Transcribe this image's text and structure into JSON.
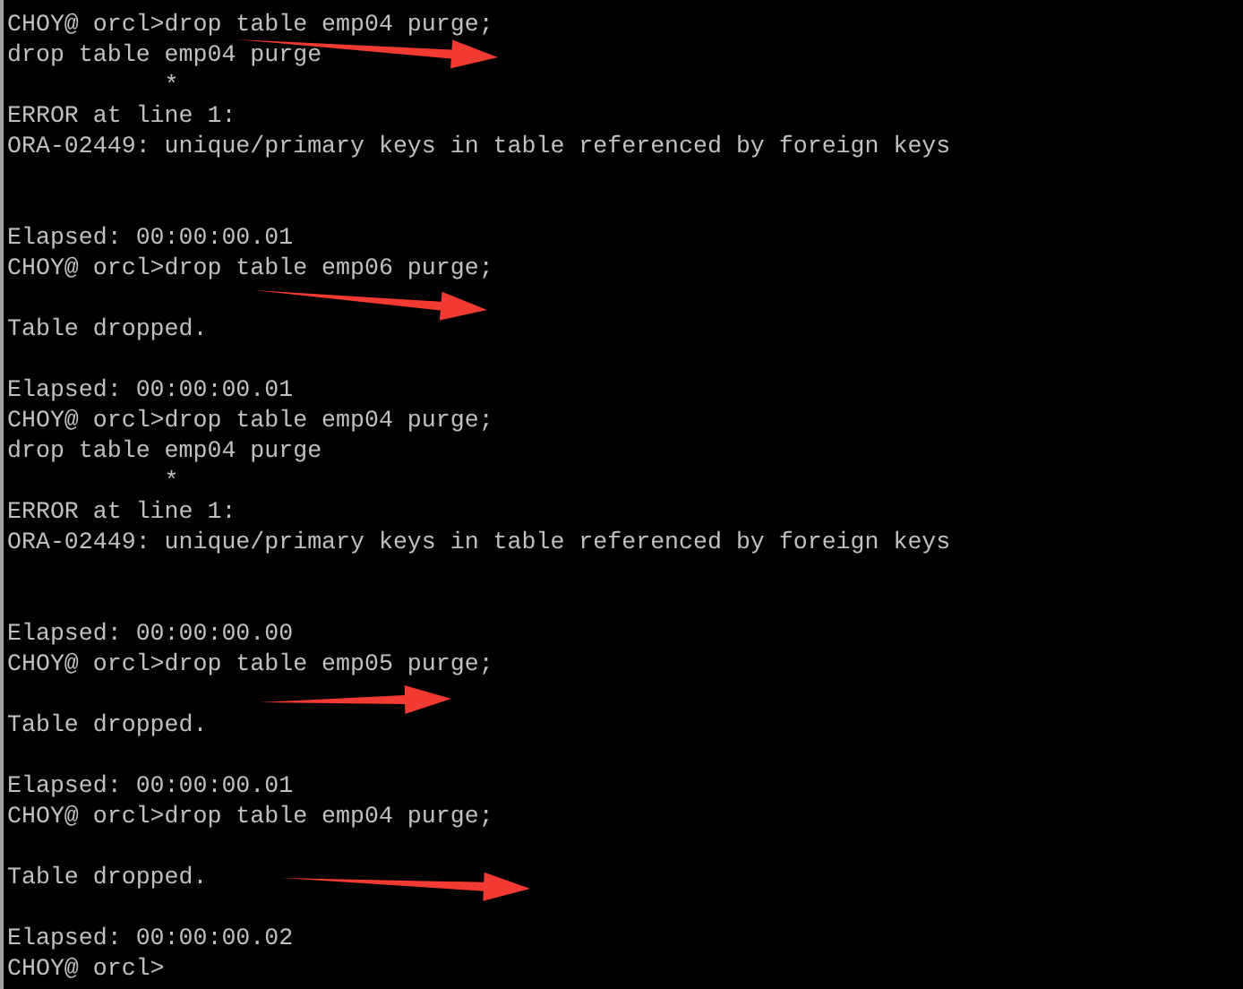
{
  "console": {
    "lines": [
      {
        "kind": "text",
        "text": "CHOY@ orcl>drop table emp04 purge;"
      },
      {
        "kind": "text",
        "text": "drop table emp04 purge"
      },
      {
        "kind": "text",
        "text": "           *"
      },
      {
        "kind": "text",
        "text": "ERROR at line 1:"
      },
      {
        "kind": "text",
        "text": "ORA-02449: unique/primary keys in table referenced by foreign keys"
      },
      {
        "kind": "blank"
      },
      {
        "kind": "blank"
      },
      {
        "kind": "text",
        "text": "Elapsed: 00:00:00.01"
      },
      {
        "kind": "text",
        "text": "CHOY@ orcl>drop table emp06 purge;"
      },
      {
        "kind": "blank"
      },
      {
        "kind": "text",
        "text": "Table dropped."
      },
      {
        "kind": "blank"
      },
      {
        "kind": "text",
        "text": "Elapsed: 00:00:00.01"
      },
      {
        "kind": "text",
        "text": "CHOY@ orcl>drop table emp04 purge;"
      },
      {
        "kind": "text",
        "text": "drop table emp04 purge"
      },
      {
        "kind": "text",
        "text": "           *"
      },
      {
        "kind": "text",
        "text": "ERROR at line 1:"
      },
      {
        "kind": "text",
        "text": "ORA-02449: unique/primary keys in table referenced by foreign keys"
      },
      {
        "kind": "blank"
      },
      {
        "kind": "blank"
      },
      {
        "kind": "text",
        "text": "Elapsed: 00:00:00.00"
      },
      {
        "kind": "text",
        "text": "CHOY@ orcl>drop table emp05 purge;"
      },
      {
        "kind": "blank"
      },
      {
        "kind": "text",
        "text": "Table dropped."
      },
      {
        "kind": "blank"
      },
      {
        "kind": "text",
        "text": "Elapsed: 00:00:00.01"
      },
      {
        "kind": "text",
        "text": "CHOY@ orcl>drop table emp04 purge;"
      },
      {
        "kind": "blank"
      },
      {
        "kind": "text",
        "text": "Table dropped."
      },
      {
        "kind": "blank"
      },
      {
        "kind": "text",
        "text": "Elapsed: 00:00:00.02"
      },
      {
        "kind": "text",
        "text": "CHOY@ orcl>"
      }
    ]
  }
}
